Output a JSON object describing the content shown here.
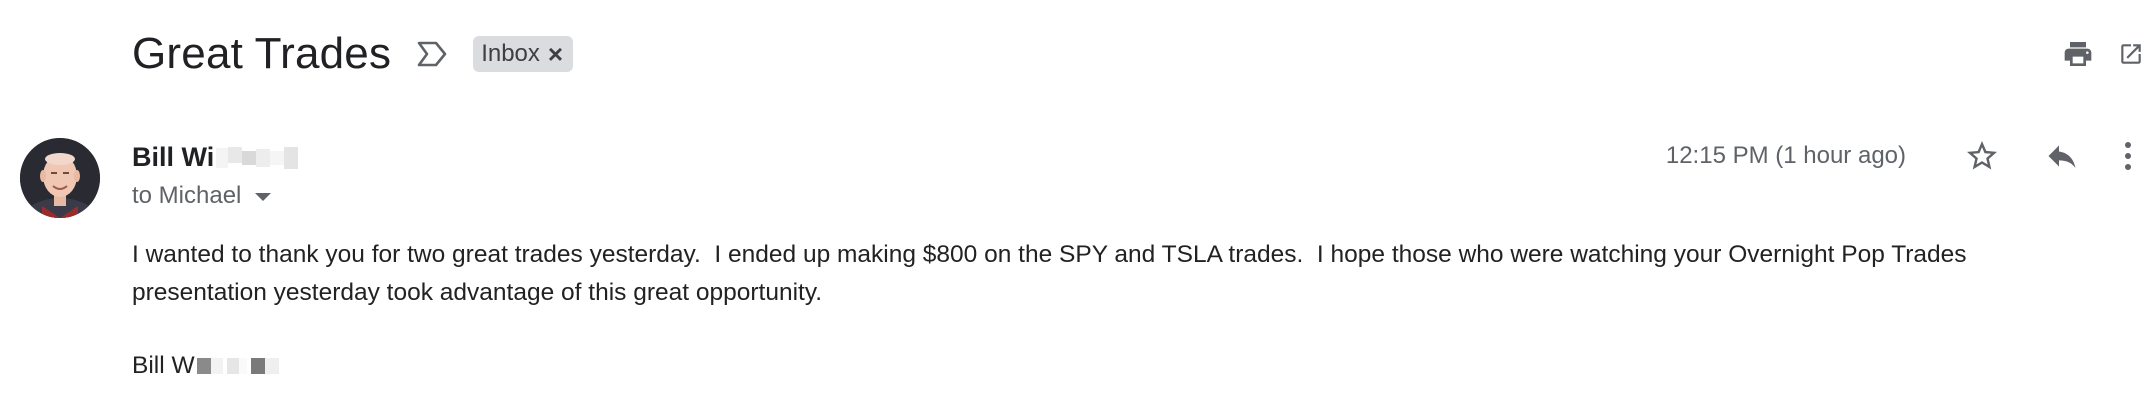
{
  "email": {
    "subject": "Great Trades",
    "label": "Inbox",
    "label_remove": "×",
    "sender_name": "Bill Wi",
    "recipient": "to Michael",
    "timestamp": "12:15 PM (1 hour ago)",
    "body_line_1": "I wanted to thank you for two great trades yesterday.  I ended up making $800 on the SPY and TSLA trades.  I hope those who were watching your Overnight Pop Trades",
    "body_line_2": "presentation yesterday took advantage of this great opportunity.",
    "signature": "Bill W"
  },
  "icons": {
    "importance": "importance-marker-icon",
    "print": "print-icon",
    "open_new_window": "open-in-new-window-icon",
    "star": "star-icon",
    "reply": "reply-icon",
    "more": "more-vertical-icon",
    "recipient_dropdown": "chevron-down-icon"
  },
  "colors": {
    "text_primary": "#202124",
    "text_secondary": "#5f6368",
    "chip_background": "#dadce0",
    "icon_color": "#5f6368"
  }
}
